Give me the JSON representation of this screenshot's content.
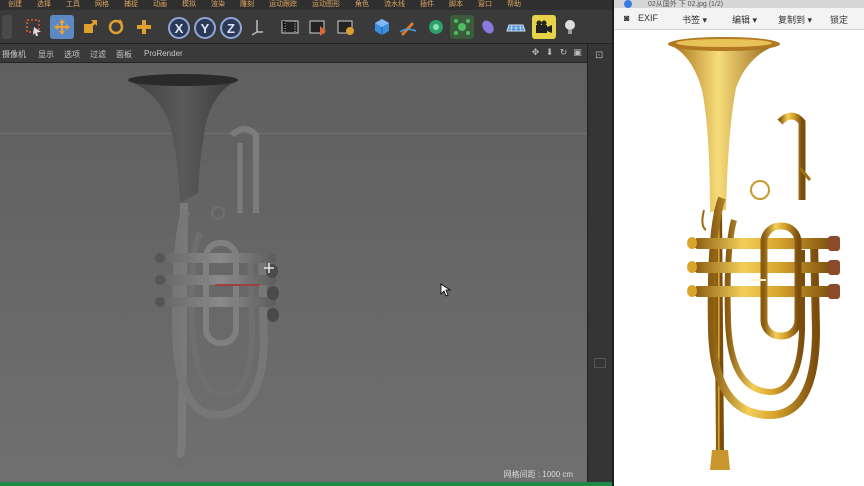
{
  "menubar": [
    "创建",
    "选择",
    "工具",
    "网格",
    "捕捉",
    "动画",
    "模拟",
    "渲染",
    "雕刻",
    "运动跟踪",
    "运动图形",
    "角色",
    "流水线",
    "插件",
    "脚本",
    "窗口",
    "帮助"
  ],
  "toolbar": {
    "axes": [
      "X",
      "Y",
      "Z"
    ],
    "icons": [
      "move-icon",
      "scale-icon",
      "rotate-icon",
      "add-icon",
      "render-view-icon",
      "render-picture-icon",
      "render-settings-icon",
      "cube-icon",
      "pen-icon",
      "subdivision-icon",
      "array-icon",
      "deformer-icon",
      "floor-icon",
      "camera-icon",
      "light-icon"
    ]
  },
  "viewport": {
    "menu": [
      "摄像机",
      "显示",
      "选项",
      "过滤",
      "面板",
      "ProRender"
    ],
    "grid_spacing": "网格间距 : 1000 cm"
  },
  "viewer": {
    "title": "02从国外 下 02.jpg (1/2)",
    "toolbar": [
      "EXIF",
      "书签 ▾",
      "编辑 ▾",
      "复制到 ▾",
      "锁定"
    ]
  },
  "colors": {
    "accent_blue": "#5a89c4",
    "model_gray": "#7a7a7a",
    "brass": "#d9a52e",
    "status_green": "#1f8a45"
  }
}
